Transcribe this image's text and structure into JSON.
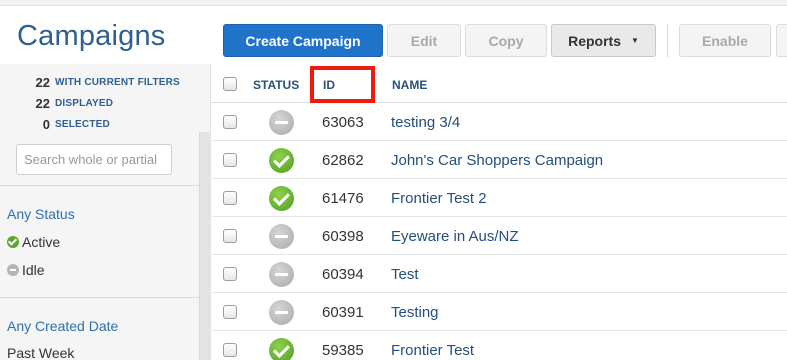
{
  "page_title": "Campaigns",
  "toolbar": {
    "create_label": "Create Campaign",
    "edit_label": "Edit",
    "copy_label": "Copy",
    "reports_label": "Reports",
    "reports_caret": "▼",
    "enable_label": "Enable"
  },
  "sidebar": {
    "counts": [
      {
        "num": "22",
        "label": "with current filters"
      },
      {
        "num": "22",
        "label": "displayed"
      },
      {
        "num": "0",
        "label": "selected"
      }
    ],
    "search_placeholder": "Search whole or partial",
    "status_filter": {
      "heading": "Any Status",
      "items": [
        {
          "label": "Active",
          "icon": "active-status-icon"
        },
        {
          "label": "Idle",
          "icon": "idle-status-icon"
        }
      ]
    },
    "date_filter": {
      "heading": "Any Created Date",
      "items": [
        {
          "label": "Past Week"
        }
      ]
    }
  },
  "table": {
    "headers": {
      "status": "STATUS",
      "id": "ID",
      "name": "NAME"
    },
    "rows": [
      {
        "status": "idle",
        "id": "63063",
        "name": "testing 3/4"
      },
      {
        "status": "active",
        "id": "62862",
        "name": "John's Car Shoppers Campaign"
      },
      {
        "status": "active",
        "id": "61476",
        "name": "Frontier Test 2"
      },
      {
        "status": "idle",
        "id": "60398",
        "name": "Eyeware in Aus/NZ"
      },
      {
        "status": "idle",
        "id": "60394",
        "name": "Test"
      },
      {
        "status": "idle",
        "id": "60391",
        "name": "Testing"
      },
      {
        "status": "active",
        "id": "59385",
        "name": "Frontier Test"
      }
    ]
  },
  "colors": {
    "accent_blue": "#1f73c9",
    "highlight_red": "#ee1c0e",
    "active_green": "#5aa82a",
    "idle_gray": "#b5b5b5"
  }
}
